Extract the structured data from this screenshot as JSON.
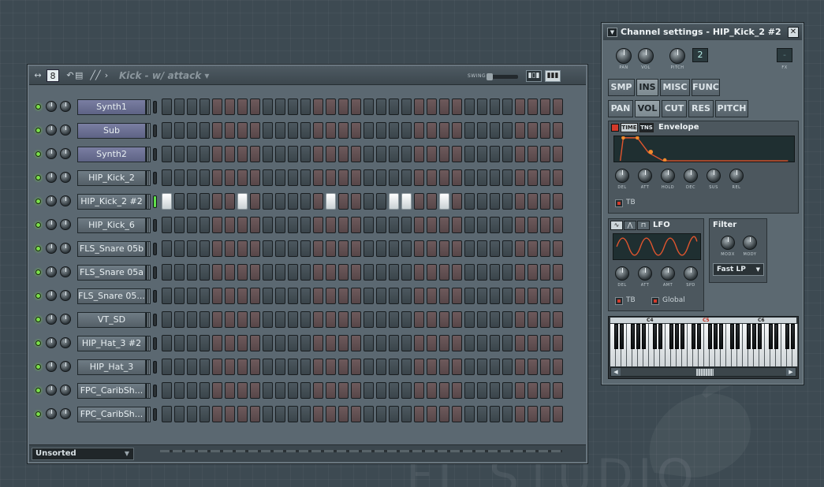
{
  "background_watermark": "FL STUDIO",
  "step_sequencer": {
    "pattern_number": "8",
    "title": "Kick - w/ attack",
    "swing_label": "SWING",
    "view_buttons": [
      "graph-view",
      "keyboard-view"
    ],
    "filter_group": "Unsorted",
    "channels": [
      {
        "name": "Synth1",
        "active": false,
        "steps_on": []
      },
      {
        "name": "Sub",
        "active": false,
        "steps_on": []
      },
      {
        "name": "Synth2",
        "active": false,
        "steps_on": []
      },
      {
        "name": "HIP_Kick_2",
        "active": false,
        "steps_on": []
      },
      {
        "name": "HIP_Kick_2 #2",
        "active": true,
        "steps_on": [
          0,
          6,
          13,
          18,
          19,
          22
        ]
      },
      {
        "name": "HIP_Kick_6",
        "active": false,
        "steps_on": []
      },
      {
        "name": "FLS_Snare 05b",
        "active": false,
        "steps_on": []
      },
      {
        "name": "FLS_Snare 05a",
        "active": false,
        "steps_on": []
      },
      {
        "name": "FLS_Snare 05...",
        "active": false,
        "steps_on": []
      },
      {
        "name": "VT_SD",
        "active": false,
        "steps_on": []
      },
      {
        "name": "HIP_Hat_3 #2",
        "active": false,
        "steps_on": []
      },
      {
        "name": "HIP_Hat_3",
        "active": false,
        "steps_on": []
      },
      {
        "name": "FPC_CaribSh...",
        "active": false,
        "steps_on": []
      },
      {
        "name": "FPC_CaribSh...",
        "active": false,
        "steps_on": []
      }
    ]
  },
  "channel_settings": {
    "title": "Channel settings - HIP_Kick_2 #2",
    "knob_labels": {
      "pan": "PAN",
      "vol": "VOL",
      "pitch": "PITCH",
      "fx": "FX"
    },
    "pitch_range": "2",
    "main_tabs": [
      "SMP",
      "INS",
      "MISC",
      "FUNC"
    ],
    "main_tab_selected": "INS",
    "target_tabs": [
      "PAN",
      "VOL",
      "CUT",
      "RES",
      "PITCH"
    ],
    "target_tab_selected": "VOL",
    "envelope": {
      "time_label": "TIME",
      "tns_label": "TNS",
      "title": "Envelope",
      "knob_labels": [
        "DEL",
        "ATT",
        "HOLD",
        "DEC",
        "SUS",
        "REL"
      ],
      "tb_label": "TB"
    },
    "lfo": {
      "title": "LFO",
      "knob_labels": [
        "DEL",
        "ATT",
        "AMT",
        "SPD"
      ],
      "tb_label": "TB",
      "global_label": "Global"
    },
    "filter": {
      "title": "Filter",
      "knob_labels": [
        "MODX",
        "MODY"
      ],
      "type": "Fast LP"
    },
    "keyboard": {
      "octave_labels": [
        "C4",
        "C5",
        "C6"
      ],
      "root_note": "C5"
    }
  }
}
